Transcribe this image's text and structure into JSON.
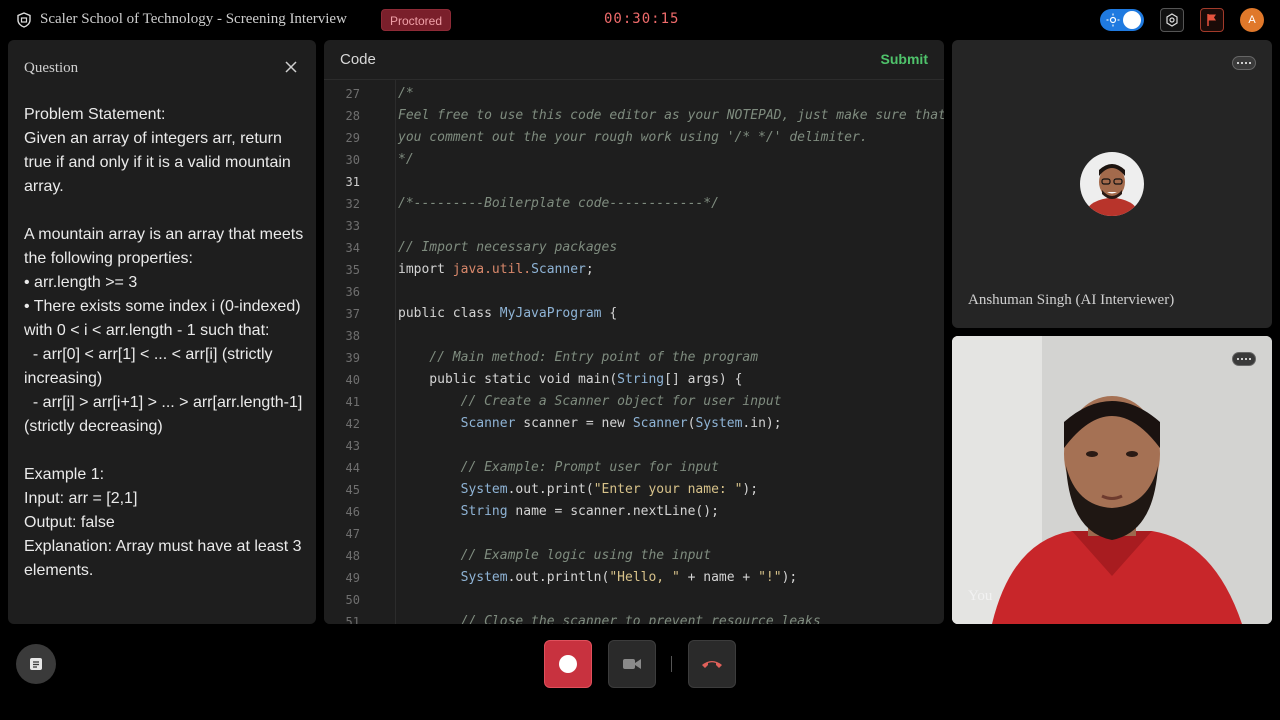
{
  "header": {
    "app_title": "Scaler School of Technology - Screening Interview",
    "badge": "Proctored",
    "timer": "00:30:15",
    "user_initial": "A"
  },
  "question": {
    "title": "Question",
    "body": "Problem Statement:\nGiven an array of integers arr, return true if and only if it is a valid mountain array.\n\nA mountain array is an array that meets the following properties:\n• arr.length >= 3\n• There exists some index i (0-indexed) with 0 < i < arr.length - 1 such that:\n  - arr[0] < arr[1] < ... < arr[i] (strictly increasing)\n  - arr[i] > arr[i+1] > ... > arr[arr.length-1] (strictly decreasing)\n\nExample 1:\nInput: arr = [2,1]\nOutput: false\nExplanation: Array must have at least 3 elements."
  },
  "editor": {
    "title": "Code",
    "submit_label": "Submit",
    "active_line": "31",
    "lines": [
      {
        "n": "27",
        "t": "/*"
      },
      {
        "n": "28",
        "t": "Feel free to use this code editor as your NOTEPAD, just make sure that"
      },
      {
        "n": "29",
        "t": "you comment out the your rough work using '/* */' delimiter."
      },
      {
        "n": "30",
        "t": "*/"
      },
      {
        "n": "31",
        "t": ""
      },
      {
        "n": "32",
        "t": "/*---------Boilerplate code------------*/"
      },
      {
        "n": "33",
        "t": ""
      },
      {
        "n": "34",
        "t": "// Import necessary packages"
      },
      {
        "n": "35",
        "t": "import java.util.Scanner;"
      },
      {
        "n": "36",
        "t": ""
      },
      {
        "n": "37",
        "t": "public class MyJavaProgram {"
      },
      {
        "n": "38",
        "t": ""
      },
      {
        "n": "39",
        "t": "    // Main method: Entry point of the program"
      },
      {
        "n": "40",
        "t": "    public static void main(String[] args) {"
      },
      {
        "n": "41",
        "t": "        // Create a Scanner object for user input"
      },
      {
        "n": "42",
        "t": "        Scanner scanner = new Scanner(System.in);"
      },
      {
        "n": "43",
        "t": ""
      },
      {
        "n": "44",
        "t": "        // Example: Prompt user for input"
      },
      {
        "n": "45",
        "t": "        System.out.print(\"Enter your name: \");"
      },
      {
        "n": "46",
        "t": "        String name = scanner.nextLine();"
      },
      {
        "n": "47",
        "t": ""
      },
      {
        "n": "48",
        "t": "        // Example logic using the input"
      },
      {
        "n": "49",
        "t": "        System.out.println(\"Hello, \" + name + \"!\");"
      },
      {
        "n": "50",
        "t": ""
      },
      {
        "n": "51",
        "t": "        // Close the scanner to prevent resource leaks"
      }
    ]
  },
  "interviewer": {
    "name": "Anshuman Singh (AI Interviewer)"
  },
  "self_view": {
    "label": "You"
  },
  "colors": {
    "accent_green": "#4fc36b",
    "record_red": "#c8323f",
    "timer_red": "#ef6b6b",
    "toggle_blue": "#1f7ae0"
  },
  "icons": {
    "logo": "shield-logo-icon",
    "theme": "sun-icon",
    "settings": "gear-icon",
    "flag": "flag-icon",
    "close": "close-icon",
    "more": "more-dots-icon",
    "notes": "notes-icon",
    "record": "record-icon",
    "camera": "video-camera-icon",
    "end_call": "end-call-icon"
  }
}
